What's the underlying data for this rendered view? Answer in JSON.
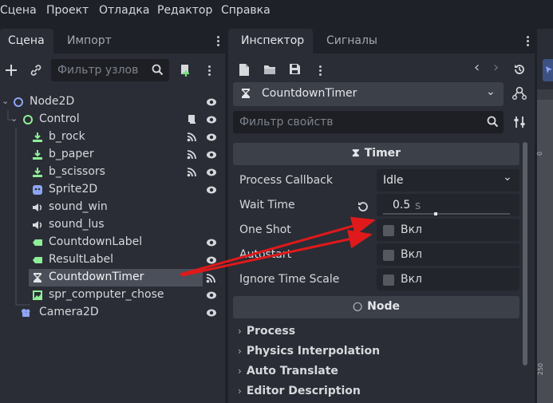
{
  "menu": [
    "Сцена",
    "Проект",
    "Отладка",
    "Редактор",
    "Справка"
  ],
  "scene_dock": {
    "tabs": [
      "Сцена",
      "Импорт"
    ],
    "filter_placeholder": "Фильтр узлов",
    "tree": [
      {
        "label": "Node2D",
        "icon": "node2d-circle-icon",
        "color": "#8da5f3"
      },
      {
        "label": "Control",
        "icon": "control-circle-icon",
        "color": "#8eef97"
      },
      {
        "label": "b_rock",
        "icon": "button-icon",
        "color": "#8eef97"
      },
      {
        "label": "b_paper",
        "icon": "button-icon",
        "color": "#8eef97"
      },
      {
        "label": "b_scissors",
        "icon": "button-icon",
        "color": "#8eef97"
      },
      {
        "label": "Sprite2D",
        "icon": "sprite2d-icon",
        "color": "#8da5f3"
      },
      {
        "label": "sound_win",
        "icon": "audio-icon",
        "color": "#d6d8dc"
      },
      {
        "label": "sound_lus",
        "icon": "audio-icon",
        "color": "#d6d8dc"
      },
      {
        "label": "CountdownLabel",
        "icon": "label-icon",
        "color": "#8eef97"
      },
      {
        "label": "ResultLabel",
        "icon": "label-icon",
        "color": "#8eef97"
      },
      {
        "label": "CountdownTimer",
        "icon": "hourglass-icon",
        "color": "#e4e6ea"
      },
      {
        "label": "spr_computer_chose",
        "icon": "texture-rect-icon",
        "color": "#8eef97"
      },
      {
        "label": "Camera2D",
        "icon": "camera2d-icon",
        "color": "#8da5f3"
      }
    ]
  },
  "inspector": {
    "tabs": [
      "Инспектор",
      "Сигналы"
    ],
    "selected_node": "CountdownTimer",
    "filter_placeholder": "Фильтр свойств",
    "section_timer": "Timer",
    "section_node": "Node",
    "props": {
      "process_callback_label": "Process Callback",
      "process_callback_value": "Idle",
      "wait_time_label": "Wait Time",
      "wait_time_value": "0.5",
      "wait_time_unit": "s",
      "one_shot_label": "One Shot",
      "autostart_label": "Autostart",
      "ignore_time_scale_label": "Ignore Time Scale",
      "toggle_label": "Вкл"
    },
    "groups": [
      "Process",
      "Physics Interpolation",
      "Auto Translate",
      "Editor Description"
    ]
  },
  "ruler": {
    "mark_0": "0",
    "mark_250": "250"
  },
  "colors": {
    "accent": "#8da5f3",
    "arrow": "#e0191b",
    "selected_row": "#4a4f59"
  }
}
